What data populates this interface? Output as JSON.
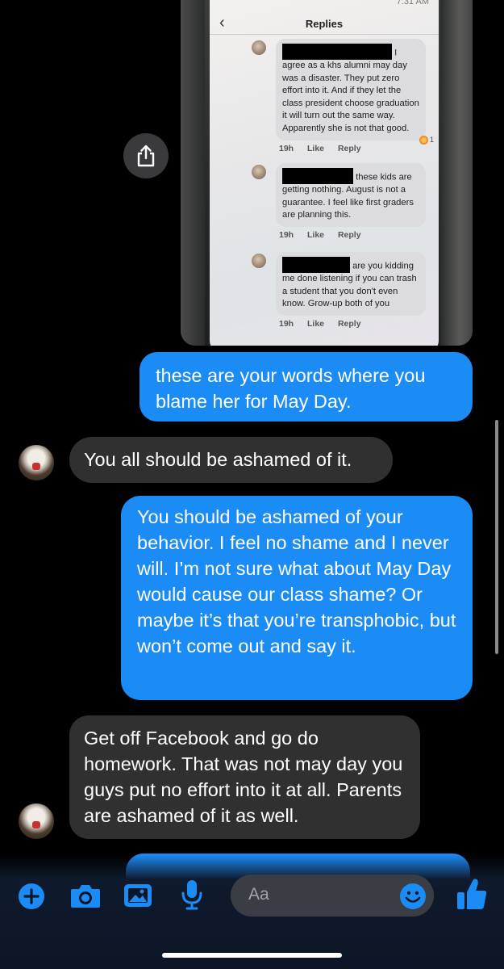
{
  "photo": {
    "status_text": "7:31 AM",
    "header_title": "Replies",
    "comments": [
      {
        "text": "I agree as a khs alumni may day was a disaster. They put zero effort into it. And if they let the class president choose graduation it will turn out the same way. Apparently she is not that good.",
        "time": "19h",
        "like": "Like",
        "reply": "Reply",
        "reaction_count": "1"
      },
      {
        "text": "these kids are getting nothing. August is not a guarantee. I feel like first graders are planning this.",
        "time": "19h",
        "like": "Like",
        "reply": "Reply"
      },
      {
        "text": "are you kidding me done listening if you can trash a student that you don't even know. Grow-up both of you",
        "time": "19h",
        "like": "Like",
        "reply": "Reply"
      }
    ]
  },
  "messages": [
    {
      "direction": "outgoing",
      "text": "these are your words where you blame her for May Day."
    },
    {
      "direction": "incoming",
      "text": "You all should be ashamed of it."
    },
    {
      "direction": "outgoing",
      "text": "You should be ashamed of your behavior. I feel no shame and I never will. I’m not sure what about May Day would cause our class shame? Or maybe it’s that you’re transphobic, but won’t come out and say it."
    },
    {
      "direction": "incoming",
      "text": "Get off Facebook and go do homework. That was not may day you guys put no effort into it at all. Parents are ashamed of it as well."
    }
  ],
  "composer": {
    "placeholder": "Aa",
    "icons": [
      "plus-icon",
      "camera-icon",
      "gallery-icon",
      "microphone-icon",
      "emoji-icon",
      "thumbs-up-icon"
    ]
  },
  "colors": {
    "outgoing_bubble": "#1b8cf6",
    "incoming_bubble": "#303030",
    "accent": "#1b8cf6",
    "background": "#000000"
  }
}
